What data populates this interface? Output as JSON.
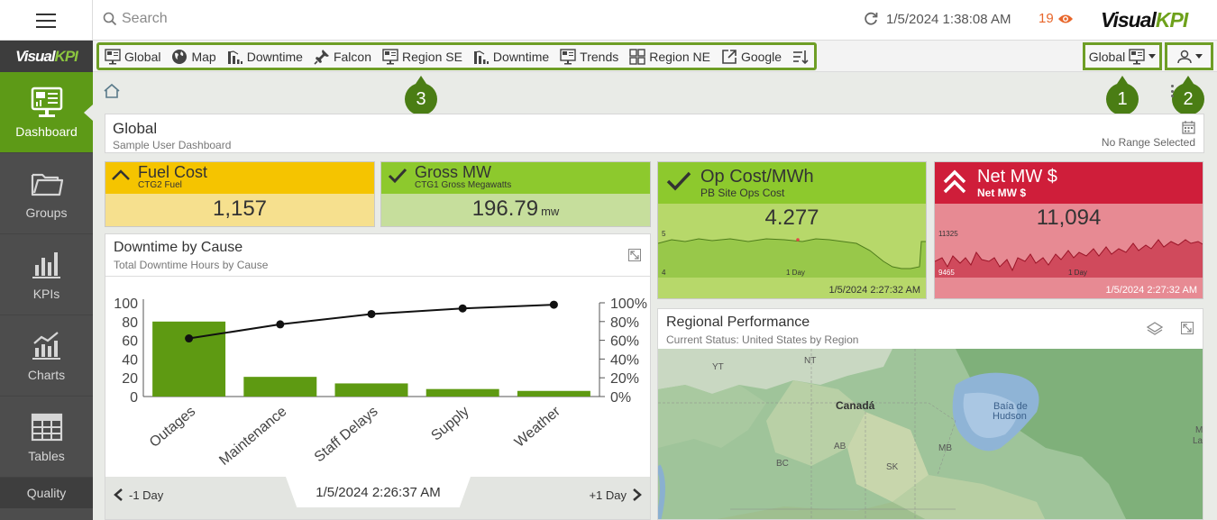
{
  "search": {
    "placeholder": "Search"
  },
  "status": {
    "timestamp": "1/5/2024 1:38:08 AM",
    "alert_count": "19"
  },
  "brand": {
    "visual": "Visual",
    "kpi": "KPI"
  },
  "sidebar": {
    "logo_visual": "Visual",
    "logo_kpi": "KPI",
    "items": [
      {
        "label": "Dashboard"
      },
      {
        "label": "Groups"
      },
      {
        "label": "KPIs"
      },
      {
        "label": "Charts"
      },
      {
        "label": "Tables"
      },
      {
        "label": "Quality"
      }
    ]
  },
  "tabs": [
    {
      "label": "Global",
      "icon": "dashboard-icon"
    },
    {
      "label": "Map",
      "icon": "globe-icon"
    },
    {
      "label": "Downtime",
      "icon": "bar-chart-icon"
    },
    {
      "label": "Falcon",
      "icon": "pin-icon"
    },
    {
      "label": "Region SE",
      "icon": "dashboard-icon"
    },
    {
      "label": "Downtime",
      "icon": "bar-chart-icon"
    },
    {
      "label": "Trends",
      "icon": "dashboard-icon"
    },
    {
      "label": "Region NE",
      "icon": "grid-icon"
    },
    {
      "label": "Google",
      "icon": "external-link-icon"
    }
  ],
  "dashboard_select": {
    "label": "Global"
  },
  "callouts": [
    "1",
    "2",
    "3"
  ],
  "header": {
    "title": "Global",
    "subtitle": "Sample User Dashboard",
    "range": "No Range Selected"
  },
  "tiles": {
    "fuel": {
      "title": "Fuel Cost",
      "subtitle": "CTG2 Fuel",
      "value": "1,157",
      "color": "#f5c400"
    },
    "gross": {
      "title": "Gross MW",
      "subtitle": "CTG1 Gross Megawatts",
      "value": "196.79",
      "unit": "mw",
      "color": "#8dc92d"
    },
    "opcost": {
      "title": "Op Cost/MWh",
      "subtitle": "PB Site Ops Cost",
      "value": "4.277",
      "y_max": "5",
      "y_min": "4",
      "period": "1 Day",
      "timestamp": "1/5/2024 2:27:32 AM",
      "color": "#8dc92d"
    },
    "netmw": {
      "title": "Net MW $",
      "subtitle": "Net MW $",
      "value": "11,094",
      "y_max": "11325",
      "y_min": "9465",
      "period": "1 Day",
      "timestamp": "1/5/2024 2:27:32 AM",
      "color": "#cf1e3a"
    }
  },
  "downtime": {
    "title": "Downtime by Cause",
    "subtitle": "Total Downtime Hours by Cause",
    "timestamp": "1/5/2024 2:26:37 AM",
    "prev_label": "-1 Day",
    "next_label": "+1 Day"
  },
  "regional": {
    "title": "Regional Performance",
    "subtitle": "Current Status: United States by Region",
    "labels": [
      "YT",
      "NT",
      "Canadá",
      "Baía de",
      "Hudson",
      "BC",
      "AB",
      "SK",
      "MB",
      "M",
      "La"
    ]
  },
  "chart_data": {
    "type": "bar",
    "categories": [
      "Outages",
      "Maintenance",
      "Staff Delays",
      "Supply",
      "Weather"
    ],
    "series": [
      {
        "values": [
          80,
          21,
          14,
          8,
          6
        ]
      },
      {
        "values": [
          62,
          77,
          88,
          94,
          98
        ]
      }
    ],
    "ylim": [
      0,
      100
    ],
    "y_ticks": [
      "0",
      "20",
      "40",
      "60",
      "80",
      "100"
    ],
    "y2_ticks": [
      "0%",
      "20%",
      "40%",
      "60%",
      "80%",
      "100%"
    ],
    "bar_color": "#5e9a12",
    "line_color": "#111111"
  }
}
